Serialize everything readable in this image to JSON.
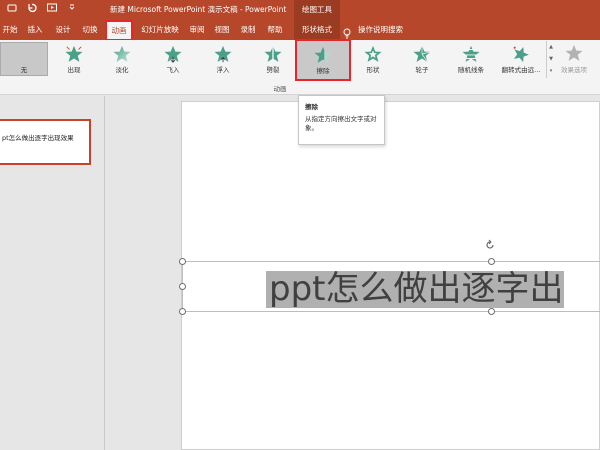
{
  "window": {
    "title": "新建 Microsoft PowerPoint 演示文稿  -  PowerPoint",
    "tool_tab_title": "绘图工具"
  },
  "quick_access": {
    "icons": [
      "autosave-icon",
      "undo-icon",
      "presenter-icon",
      "customize-icon"
    ]
  },
  "tabs": [
    {
      "label": "开始"
    },
    {
      "label": "插入"
    },
    {
      "label": "设计"
    },
    {
      "label": "切换"
    },
    {
      "label": "动画",
      "active": true
    },
    {
      "label": "幻灯片放映"
    },
    {
      "label": "审阅"
    },
    {
      "label": "视图"
    },
    {
      "label": "录制"
    },
    {
      "label": "帮助"
    },
    {
      "label": "形状格式",
      "contextual": true
    }
  ],
  "search_hint": "操作说明搜索",
  "ribbon": {
    "effects": [
      {
        "label": "无",
        "icon": "none-star-icon"
      },
      {
        "label": "出现",
        "icon": "appear-icon"
      },
      {
        "label": "淡化",
        "icon": "fade-icon"
      },
      {
        "label": "飞入",
        "icon": "fly-in-icon"
      },
      {
        "label": "浮入",
        "icon": "float-in-icon"
      },
      {
        "label": "劈裂",
        "icon": "split-icon"
      },
      {
        "label": "擦除",
        "icon": "wipe-icon",
        "selected": true
      },
      {
        "label": "形状",
        "icon": "shape-icon"
      },
      {
        "label": "轮子",
        "icon": "wheel-icon"
      },
      {
        "label": "随机线条",
        "icon": "random-bars-icon"
      },
      {
        "label": "翻转式由远...",
        "icon": "grow-turn-icon"
      }
    ],
    "more_label": "效果选项",
    "group_label": "动画"
  },
  "tooltip": {
    "title": "擦除",
    "description": "从指定方向擦出文字或对象。"
  },
  "thumbnail": {
    "text": "pt怎么做出逐字出现效果"
  },
  "slide": {
    "text": "ppt怎么做出逐字出"
  },
  "colors": {
    "accent": "#b7472a",
    "star_green": "#4aa088",
    "highlight_red": "#e8262a"
  }
}
